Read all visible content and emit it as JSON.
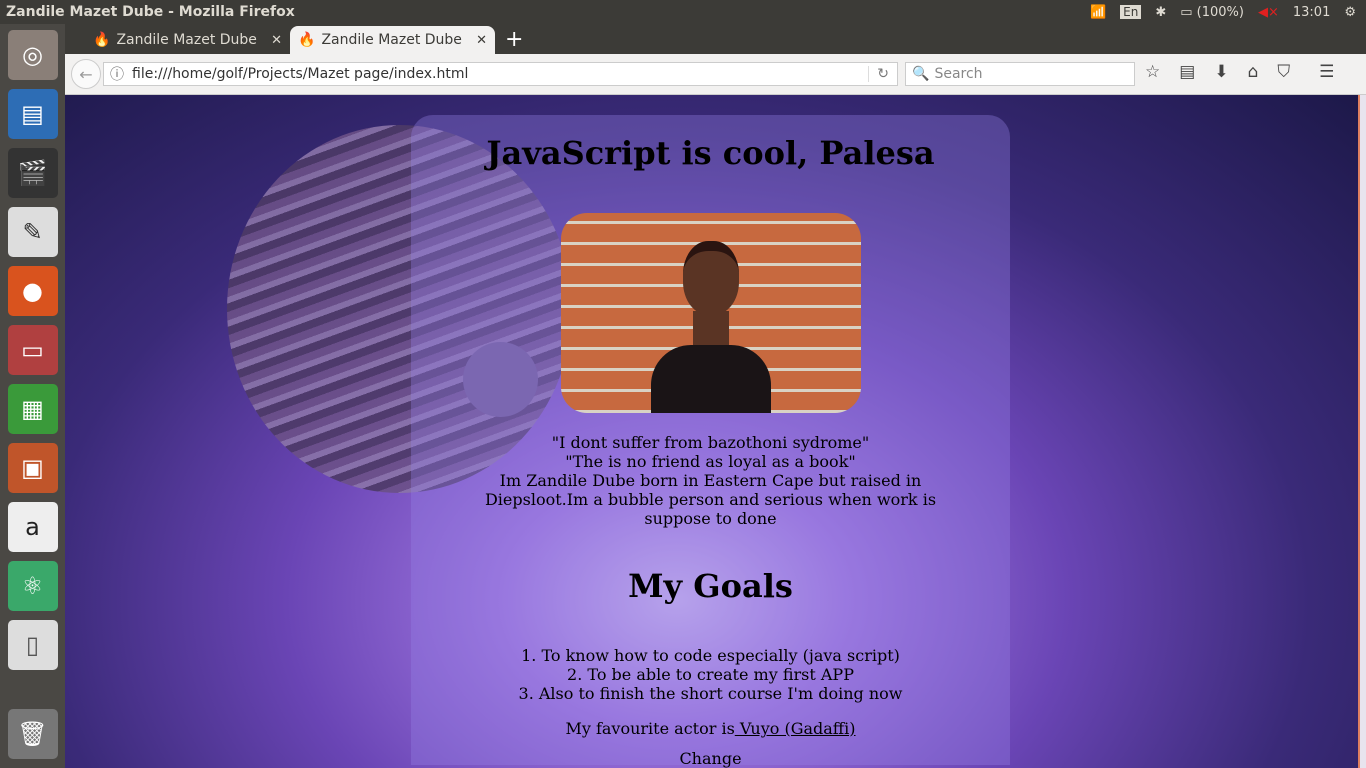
{
  "window": {
    "title": "Zandile Mazet Dube - Mozilla Firefox"
  },
  "tray": {
    "lang": "En",
    "battery": "(100%)",
    "time": "13:01"
  },
  "launcher": [
    "ubuntu-dash",
    "libreoffice-writer",
    "videos",
    "text-editor",
    "firefox",
    "files",
    "libreoffice-calc",
    "libreoffice-impress",
    "amazon",
    "atom",
    "libreoffice",
    "trash"
  ],
  "tabs": [
    {
      "label": "Zandile Mazet Dube",
      "active": false
    },
    {
      "label": "Zandile Mazet Dube",
      "active": true
    }
  ],
  "nav": {
    "url": "file:///home/golf/Projects/Mazet page/index.html",
    "search_placeholder": "Search"
  },
  "page": {
    "title": "JavaScript is cool, Palesa",
    "quote1": "\"I dont suffer from bazothoni sydrome\"",
    "quote2": "\"The is no friend as loyal as a book\"",
    "bio": "Im Zandile Dube born in Eastern Cape but raised in Diepsloot.Im a bubble person and serious when work is suppose to done",
    "goals_heading": "My Goals",
    "goals": [
      "1. To know how to code especially (java script)",
      "2. To be able to create my first APP",
      "3. Also to finish the short course I'm doing now"
    ],
    "actor_prefix": "My favourite actor is",
    "actor_link": " Vuyo (Gadaffi)",
    "change": "Change"
  }
}
